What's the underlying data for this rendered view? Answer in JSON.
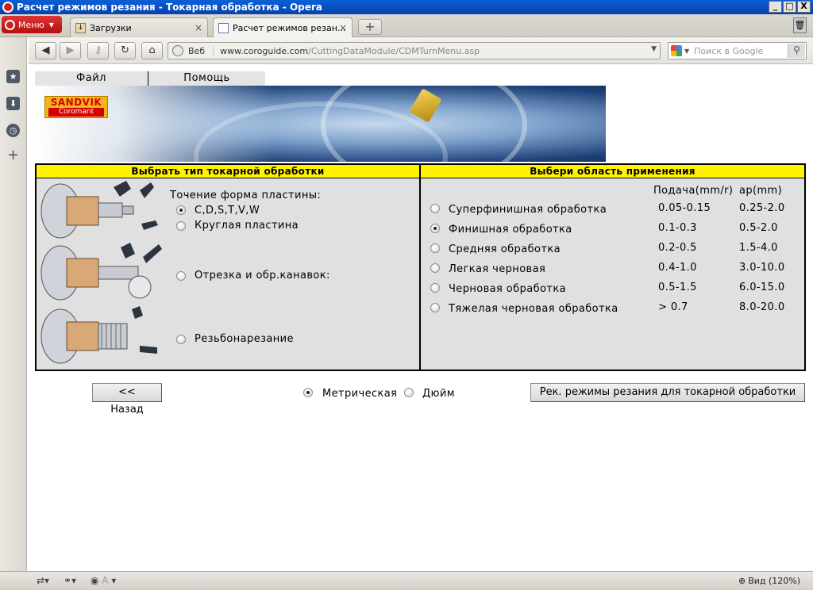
{
  "window": {
    "title": "Расчет режимов резания - Токарная обработка - Opera",
    "buttons": {
      "minimize": "_",
      "maximize": "□",
      "close": "X"
    }
  },
  "browser": {
    "menu_label": "Меню",
    "tabs": [
      {
        "label": "Загрузки",
        "close": "×"
      },
      {
        "label": "Расчет режимов резан...",
        "close": "×"
      }
    ],
    "new_tab": "+",
    "address": {
      "scheme_label": "Веб",
      "host": "www.coroguide.com",
      "path": "/CuttingDataModule/CDMTurnMenu.asp"
    },
    "search_placeholder": "Поиск в Google",
    "status": {
      "zoom": "Вид (120%)",
      "view_mode": "A"
    }
  },
  "page": {
    "menu": {
      "file": "Файл",
      "help": "Помощь"
    },
    "logo": {
      "line1": "SANDVIK",
      "line2": "Coromant"
    },
    "left_panel": {
      "header": "Выбрать тип токарной обработки",
      "intro": "Точение форма пластины:",
      "options": [
        {
          "label": "C,D,S,T,V,W",
          "checked": true
        },
        {
          "label": "Круглая пластина",
          "checked": false
        },
        {
          "label": "Отрезка и обр.канавок:",
          "checked": false
        },
        {
          "label": "Резьбонарезание",
          "checked": false
        }
      ]
    },
    "right_panel": {
      "header": "Выбери область применения",
      "col_feed": "Подача(mm/r)",
      "col_ap": "ap(mm)",
      "rows": [
        {
          "label": "Суперфинишная обработка",
          "feed": "0.05-0.15",
          "ap": "0.25-2.0",
          "checked": false
        },
        {
          "label": "Финишная обработка",
          "feed": "0.1-0.3",
          "ap": "0.5-2.0",
          "checked": true
        },
        {
          "label": "Средняя обработка",
          "feed": "0.2-0.5",
          "ap": "1.5-4.0",
          "checked": false
        },
        {
          "label": "Легкая черновая",
          "feed": "0.4-1.0",
          "ap": "3.0-10.0",
          "checked": false
        },
        {
          "label": "Черновая обработка",
          "feed": "0.5-1.5",
          "ap": "6.0-15.0",
          "checked": false
        },
        {
          "label": "Тяжелая черновая обработка",
          "feed": "> 0.7",
          "ap": "8.0-20.0",
          "checked": false
        }
      ]
    },
    "back_button": "<< Назад",
    "units": [
      {
        "label": "Метрическая",
        "checked": true
      },
      {
        "label": "Дюйм",
        "checked": false
      }
    ],
    "submit_button": "Рек. режимы резания для токарной обработки"
  }
}
